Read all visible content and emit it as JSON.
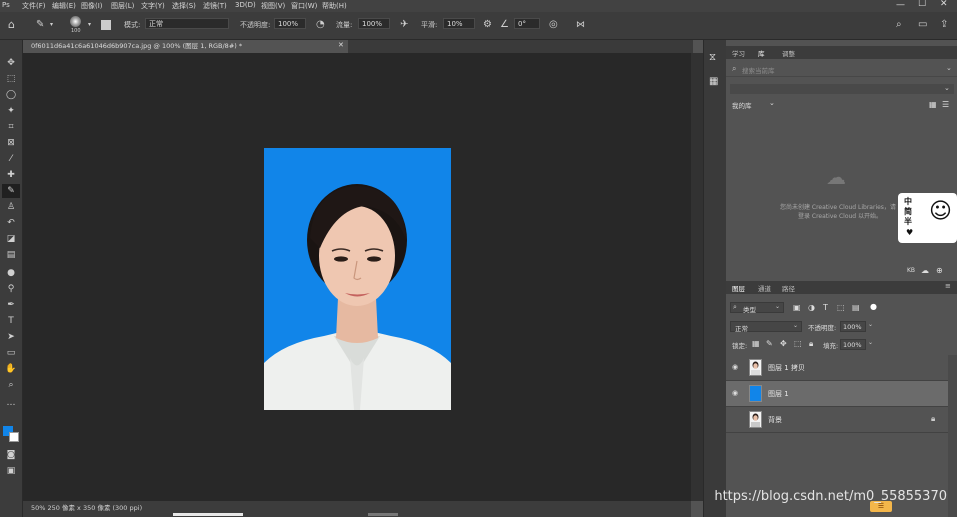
{
  "menu": [
    "文件(F)",
    "编辑(E)",
    "图像(I)",
    "图层(L)",
    "文字(Y)",
    "选择(S)",
    "滤镜(T)",
    "3D(D)",
    "视图(V)",
    "窗口(W)",
    "帮助(H)"
  ],
  "options": {
    "mode_label": "模式:",
    "mode_value": "正常",
    "opacity_label": "不透明度:",
    "opacity_value": "100%",
    "flow_label": "流量:",
    "flow_value": "100%",
    "smooth_label": "平滑:",
    "smooth_value": "10%",
    "angle_value": "0°",
    "brush_size": "100"
  },
  "document": {
    "tab_title": "0f6011d6a41c6a61046d6b907ca.jpg @ 100% (图层 1, RGB/8#) *",
    "status_text": "50%    250 像素 x 350 像素 (300 ppi)"
  },
  "libraries": {
    "tabs": [
      "学习",
      "库",
      "调整"
    ],
    "search_placeholder": "搜索当前库",
    "dropdown_label": "我的库",
    "empty_line1": "您尚未创建 Creative Cloud Libraries，请",
    "empty_line2": "登录 Creative Cloud 以开始。",
    "kb_label": "KB"
  },
  "layers": {
    "tabs": [
      "图层",
      "通道",
      "路径"
    ],
    "filter_label": "类型",
    "blend_mode": "正常",
    "opacity_label": "不透明度:",
    "opacity_value": "100%",
    "lock_label": "锁定:",
    "fill_label": "填充:",
    "fill_value": "100%",
    "items": [
      {
        "name": "图层 1 拷贝",
        "visible": true,
        "selected": false,
        "thumb": "portrait"
      },
      {
        "name": "图层 1",
        "visible": true,
        "selected": true,
        "thumb": "blue"
      },
      {
        "name": "背景",
        "visible": false,
        "selected": false,
        "thumb": "portrait"
      }
    ]
  },
  "sticker": {
    "text": "中简半"
  },
  "watermark": "https://blog.csdn.net/m0_55855370",
  "colors": {
    "foreground": "#1185e9",
    "background": "#ffffff",
    "photo_bg": "#1185e9"
  }
}
